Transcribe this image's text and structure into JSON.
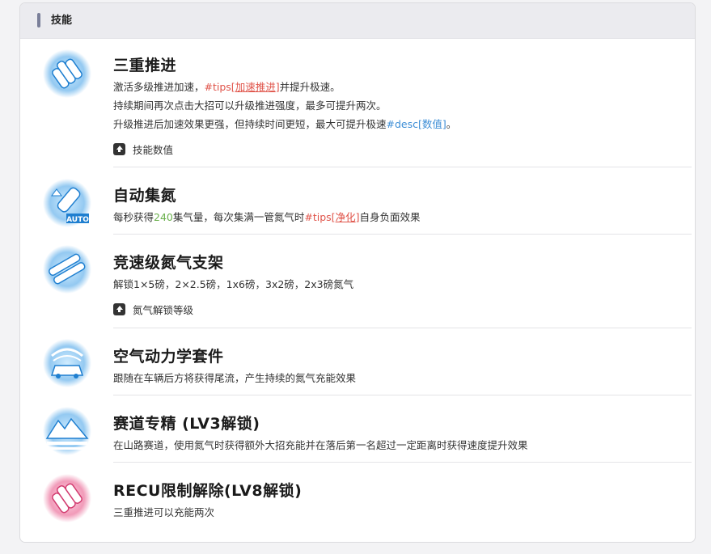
{
  "header": {
    "title": "技能"
  },
  "colors": {
    "accent_red": "#e0544a",
    "accent_blue": "#3d8ed6",
    "accent_green": "#6ab04c",
    "icon_blue": "#4aa8e8",
    "icon_pink": "#e8588a"
  },
  "skills": [
    {
      "icon": "nitro-triple-icon",
      "title": "三重推进",
      "lines": [
        {
          "a": "激活多级推进加速，",
          "tag": "#tips[",
          "link": "加速推进",
          "close": "]",
          "b": "并提升极速。"
        },
        {
          "text": "持续期间再次点击大招可以升级推进强度，最多可提升两次。"
        },
        {
          "a": "升级推进后加速效果更强，但持续时间更短，最大可提升极速",
          "tag": "#desc[",
          "link": "数值",
          "close": "]",
          "b": "。"
        }
      ],
      "expander": "技能数值"
    },
    {
      "icon": "auto-nitro-icon",
      "title": "自动集氮",
      "lines": [
        {
          "a": "每秒获得",
          "num": "240",
          "b": "集气量，每次集满一管氮气时",
          "tag": "#tips[",
          "link": "净化",
          "close": "]",
          "c": "自身负面效果"
        }
      ]
    },
    {
      "icon": "nitro-rack-icon",
      "title": "竞速级氮气支架",
      "lines": [
        {
          "text": "解锁1×5磅，2×2.5磅，1x6磅，3x2磅，2x3磅氮气"
        }
      ],
      "expander": "氮气解锁等级"
    },
    {
      "icon": "aero-kit-icon",
      "title": "空气动力学套件",
      "lines": [
        {
          "text": "跟随在车辆后方将获得尾流，产生持续的氮气充能效果"
        }
      ]
    },
    {
      "icon": "mountain-track-icon",
      "title": "赛道专精 (LV3解锁)",
      "lines": [
        {
          "text": "在山路赛道，使用氮气时获得额外大招充能并在落后第一名超过一定距离时获得速度提升效果"
        }
      ]
    },
    {
      "icon": "recu-unlock-icon",
      "title": "RECU限制解除(LV8解锁)",
      "lines": [
        {
          "text": "三重推进可以充能两次"
        }
      ]
    }
  ]
}
